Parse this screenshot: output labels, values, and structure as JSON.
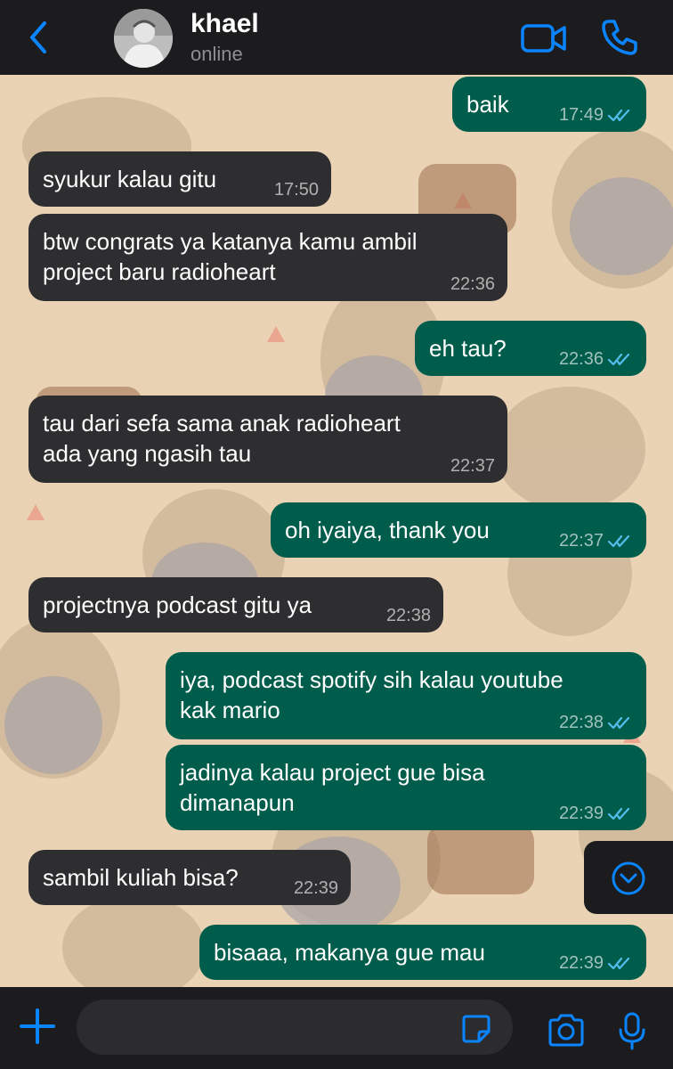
{
  "header": {
    "contact_name": "khael",
    "status": "online",
    "back_icon": "chevron-left-icon",
    "video_icon": "video-call-icon",
    "call_icon": "phone-icon"
  },
  "colors": {
    "accent": "#0a84ff",
    "incoming_bubble": "#2e2e30",
    "outgoing_bubble": "#005c4b",
    "header_bg": "#1c1c1e",
    "wallpaper": "#e9d3b4",
    "read_ticks": "#53bdeb"
  },
  "messages": [
    {
      "dir": "out",
      "text": "baik",
      "time": "17:49",
      "read": true
    },
    {
      "dir": "in",
      "text": "syukur kalau gitu",
      "time": "17:50"
    },
    {
      "dir": "in",
      "text": "btw congrats ya katanya kamu ambil\nproject baru radioheart",
      "time": "22:36"
    },
    {
      "dir": "out",
      "text": "eh tau?",
      "time": "22:36",
      "read": true
    },
    {
      "dir": "in",
      "text": "tau dari sefa sama anak radioheart\nada yang ngasih tau",
      "time": "22:37"
    },
    {
      "dir": "out",
      "text": "oh iyaiya, thank you",
      "time": "22:37",
      "read": true
    },
    {
      "dir": "in",
      "text": "projectnya podcast gitu ya",
      "time": "22:38"
    },
    {
      "dir": "out",
      "text": "iya, podcast spotify sih kalau youtube\nkak mario",
      "time": "22:38",
      "read": true
    },
    {
      "dir": "out",
      "text": "jadinya kalau project gue bisa\ndimanapun",
      "time": "22:39",
      "read": true
    },
    {
      "dir": "in",
      "text": "sambil kuliah bisa?",
      "time": "22:39"
    },
    {
      "dir": "out",
      "text": "bisaaa, makanya gue mau",
      "time": "22:39",
      "read": true
    }
  ],
  "scroll_down_icon": "chevron-down-circle-icon",
  "composer": {
    "placeholder": "",
    "plus_icon": "plus-icon",
    "sticker_icon": "sticker-icon",
    "camera_icon": "camera-icon",
    "mic_icon": "microphone-icon"
  }
}
